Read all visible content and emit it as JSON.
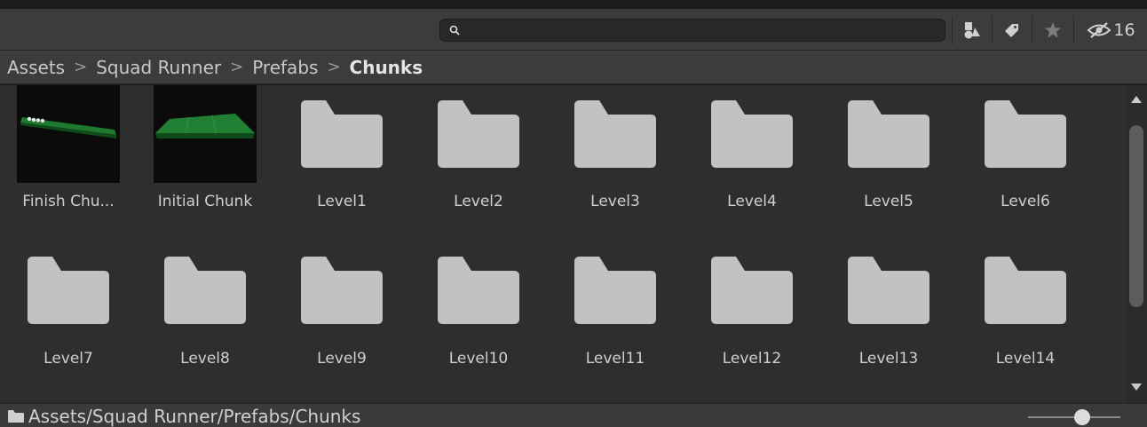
{
  "toolbar": {
    "search_placeholder": "",
    "hidden_count": "16",
    "buttons": [
      {
        "icon": "type-filter-icon"
      },
      {
        "icon": "label-filter-icon"
      },
      {
        "icon": "favorite-star-icon"
      },
      {
        "icon": "hidden-eye-icon"
      }
    ]
  },
  "breadcrumb": {
    "items": [
      "Assets",
      "Squad Runner",
      "Prefabs"
    ],
    "current": "Chunks",
    "separator": ">"
  },
  "assets": {
    "row1": [
      "Finish Chu...",
      "Initial Chunk",
      "Level1",
      "Level2",
      "Level3",
      "Level4",
      "Level5",
      "Level6"
    ],
    "row2": [
      "Level7",
      "Level8",
      "Level9",
      "Level10",
      "Level11",
      "Level12",
      "Level13",
      "Level14"
    ]
  },
  "status": {
    "path": "Assets/Squad Runner/Prefabs/Chunks",
    "zoom_level": 0.5
  },
  "colors": {
    "panel_bg": "#2e2e2e",
    "toolbar_bg": "#3c3c3c",
    "folder": "#c2c2c2",
    "prefab_green": "#1f7a30"
  }
}
